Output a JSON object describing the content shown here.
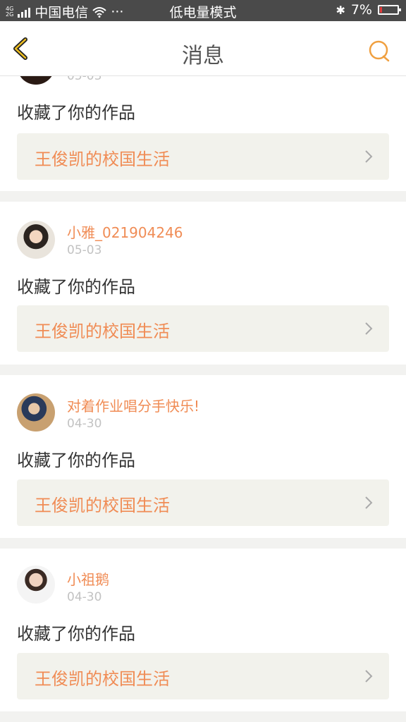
{
  "status_bar": {
    "network_top": "4G",
    "network_bottom": "2G",
    "carrier": "中国电信",
    "dots": "···",
    "mode": "低电量模式",
    "bluetooth": "✱",
    "battery_percent": "7%",
    "battery_level": 0.07,
    "battery_color": "#e23c3c"
  },
  "nav": {
    "title": "消息",
    "back_icon": "chevron-left-icon",
    "right_icon": "chat-bubble-icon",
    "accent_color": "#f0a040"
  },
  "items": [
    {
      "user": "",
      "date": "05-03",
      "action": "收藏了你的作品",
      "work_title": "王俊凯的校国生活"
    },
    {
      "user": "小雅_021904246",
      "date": "05-03",
      "action": "收藏了你的作品",
      "work_title": "王俊凯的校国生活"
    },
    {
      "user": "对着作业唱分手快乐!",
      "date": "04-30",
      "action": "收藏了你的作品",
      "work_title": "王俊凯的校国生活"
    },
    {
      "user": "小祖鹅",
      "date": "04-30",
      "action": "收藏了你的作品",
      "work_title": "王俊凯的校国生活"
    }
  ]
}
